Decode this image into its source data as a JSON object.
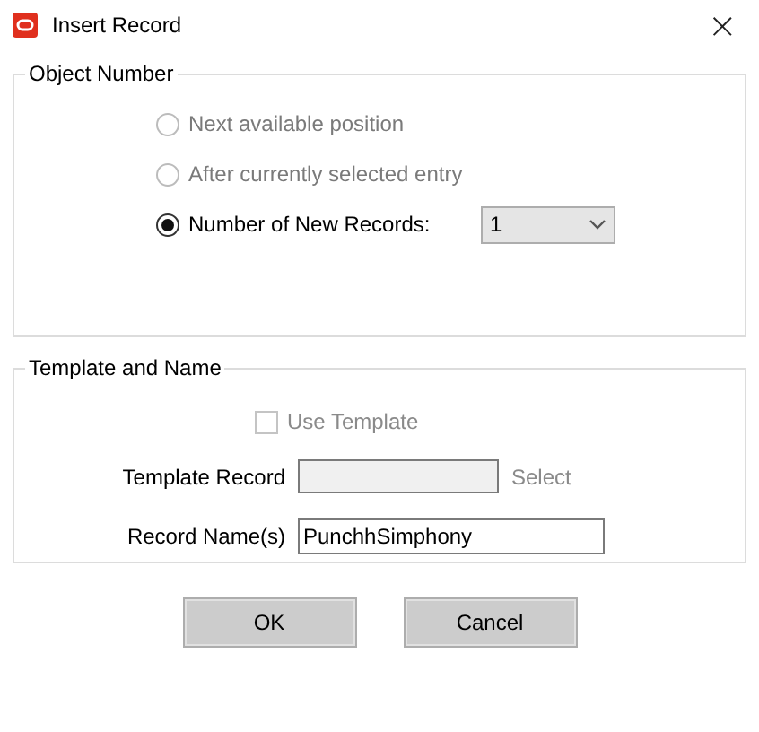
{
  "window": {
    "title": "Insert Record",
    "close": "×"
  },
  "object_number": {
    "title": "Object Number",
    "options": [
      {
        "label": "Next available position",
        "selected": false,
        "disabled": true
      },
      {
        "label": "After currently selected entry",
        "selected": false,
        "disabled": true
      },
      {
        "label": "Number of New Records:",
        "selected": true,
        "disabled": false
      }
    ],
    "count_dropdown": {
      "value": "1"
    }
  },
  "template_and_name": {
    "title": "Template and Name",
    "use_template": {
      "label": "Use Template",
      "checked": false,
      "disabled": true
    },
    "template_record": {
      "label": "Template Record",
      "disabled": true,
      "action": "Select"
    },
    "record_names": {
      "label": "Record Name(s)",
      "value": "PunchhSimphony"
    }
  },
  "buttons": [
    "OK",
    "Cancel"
  ]
}
